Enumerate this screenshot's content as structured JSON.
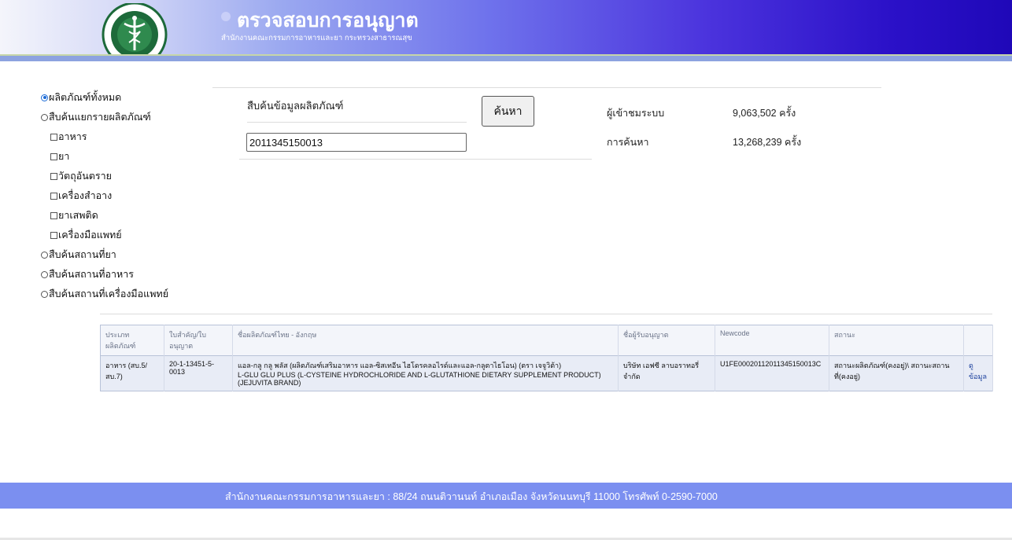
{
  "header": {
    "title": "ตรวจสอบการอนุญาต",
    "subtitle": "สำนักงานคณะกรรมการอาหารและยา กระทรวงสาธารณสุข",
    "logo_icon": "ministry-of-public-health-seal"
  },
  "options": {
    "all_products": "ผลิตภัณฑ์ทั้งหมด",
    "by_product": "สืบค้นแยกรายผลิตภัณฑ์",
    "categories": [
      "อาหาร",
      "ยา",
      "วัตถุอันตราย",
      "เครื่องสำอาง",
      "ยาเสพติด",
      "เครื่องมือแพทย์"
    ],
    "drug_place": "สืบค้นสถานที่ยา",
    "food_place": "สืบค้นสถานที่อาหาร",
    "device_place": "สืบค้นสถานที่เครื่องมือแพทย์",
    "selected": "all_products"
  },
  "search": {
    "label": "สืบค้นข้อมูลผลิตภัณฑ์",
    "value": "2011345150013",
    "button": "ค้นหา"
  },
  "stats": {
    "visitors_label": "ผู้เข้าชมระบบ",
    "visitors_value": "9,063,502 ครั้ง",
    "searches_label": "การค้นหา",
    "searches_value": "13,268,239 ครั้ง"
  },
  "table": {
    "headers": [
      "ประเภท ผลิตภัณฑ์",
      "ใบสำคัญ/ใบ อนุญาต",
      "ชื่อผลิตภัณฑ์ไทย - อังกฤษ",
      "ชื่อผู้รับอนุญาต",
      "Newcode",
      "สถานะ",
      ""
    ],
    "rows": [
      {
        "type": "อาหาร (สบ.5/สบ.7)",
        "license": "20-1-13451-5-0013",
        "name_th": "แอล-กลู กลู พลัส (ผลิตภัณฑ์เสริมอาหาร แอล-ซิสเทอีน ไฮโดรคลอไรด์และแอล-กลูตาไธโอน) (ตรา เจจูวิต้า)",
        "name_en": "L-GLU GLU PLUS (L-CYSTEINE HYDROCHLORIDE AND L-GLUTATHIONE DIETARY SUPPLEMENT PRODUCT) (JEJUVITA BRAND)",
        "licensee": "บริษัท เอฟซี ลาบอราทอรี่ จำกัด",
        "newcode": "U1FE0002011201134515001​3C",
        "status": "สถานะผลิตภัณฑ์(คงอยู่)\\ สถานะสถานที่(คงอยู่)",
        "action": "ดูข้อมูล"
      }
    ]
  },
  "footer": {
    "text": "สำนักงานคณะกรรมการอาหารและยา : 88/24 ถนนติวานนท์ อำเภอเมือง จังหวัดนนทบุรี 11000 โทรศัพท์ 0-2590-7000"
  }
}
